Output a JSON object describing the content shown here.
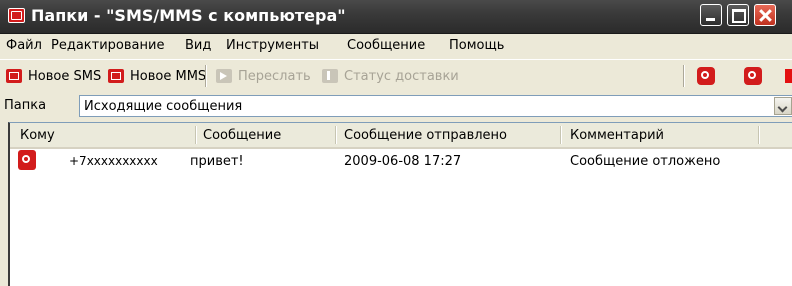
{
  "window": {
    "title": "Папки - \"SMS/MMS с компьютера\""
  },
  "menu": [
    {
      "label": "Файл"
    },
    {
      "label": "Редактирование"
    },
    {
      "label": "Вид"
    },
    {
      "label": "Инструменты"
    },
    {
      "label": "Сообщение"
    },
    {
      "label": "Помощь"
    }
  ],
  "toolbar": {
    "new_sms": "Новое SMS",
    "new_mms": "Новое MMS",
    "forward": "Переслать",
    "delivery_status": "Статус доставки"
  },
  "folder": {
    "label": "Папка",
    "selected": "Исходящие сообщения"
  },
  "table": {
    "columns": [
      "Кому",
      "Сообщение",
      "Сообщение отправлено",
      "Комментарий"
    ],
    "rows": [
      {
        "to": "+7xxxxxxxxxx",
        "message": "привет!",
        "sent": "2009-06-08 17:27",
        "comment": "Сообщение отложено"
      }
    ]
  },
  "colors": {
    "accent_red": "#d21c1c",
    "titlebar": "#3a3a3a",
    "window_bg": "#ece9d8"
  }
}
